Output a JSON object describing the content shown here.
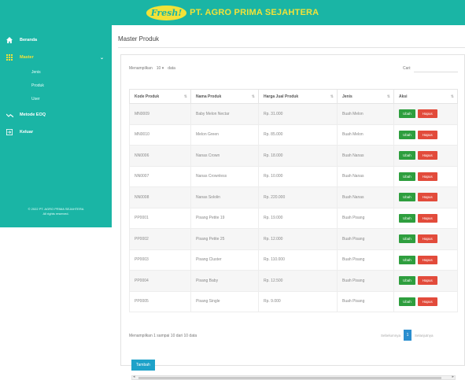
{
  "header": {
    "logo_text": "Fresh!",
    "company": "PT. AGRO PRIMA SEJAHTERA"
  },
  "sidebar": {
    "items": [
      {
        "label": "Beranda",
        "icon": "home-icon"
      },
      {
        "label": "Master",
        "icon": "grid-icon"
      },
      {
        "label": "Metode EOQ",
        "icon": "chart-icon"
      },
      {
        "label": "Keluar",
        "icon": "logout-icon"
      }
    ],
    "submenu": [
      "Jenis",
      "Produk",
      "User"
    ],
    "footer_line1": "© 2022 PT. AGRO PRIMA SEJAHTERA",
    "footer_line2": "All rights reserved."
  },
  "main": {
    "title": "Master Produk",
    "show_label": "Menampilkan",
    "show_value": "10",
    "show_suffix": "data",
    "search_label": "Cari:",
    "columns": [
      "Kode Produk",
      "Nama Produk",
      "Harga Jual Produk",
      "Jenis",
      "Aksi"
    ],
    "rows": [
      [
        "MN0009",
        "Baby Melon Nectar",
        "Rp. 31.000",
        "Buah Melon"
      ],
      [
        "MN0010",
        "Melon Green",
        "Rp. 85.000",
        "Buah Melon"
      ],
      [
        "NN0006",
        "Nanas Crown",
        "Rp. 18.000",
        "Buah Nanas"
      ],
      [
        "NN0007",
        "Nanas Crownless",
        "Rp. 10.000",
        "Buah Nanas"
      ],
      [
        "NN0008",
        "Nanas Sololin",
        "Rp. 220.000",
        "Buah Nanas"
      ],
      [
        "PP0001",
        "Pisang Petite 19",
        "Rp. 19.000",
        "Buah Pisang"
      ],
      [
        "PP0002",
        "Pisang Petite 25",
        "Rp. 12.000",
        "Buah Pisang"
      ],
      [
        "PP0003",
        "Pisang Cluster",
        "Rp. 110.000",
        "Buah Pisang"
      ],
      [
        "PP0004",
        "Pisang Baby",
        "Rp. 12.500",
        "Buah Pisang"
      ],
      [
        "PP0005",
        "Pisang Single",
        "Rp. 9.000",
        "Buah Pisang"
      ]
    ],
    "edit_label": "Ubah",
    "delete_label": "Hapus",
    "info": "Menampilkan 1 sampai 10 dari 10 data",
    "prev_label": "Sebelumnya",
    "page": "1",
    "next_label": "Selanjutnya",
    "add_label": "Tambah"
  },
  "colors": {
    "teal": "#1ab5a5",
    "yellow": "#f2e238",
    "green": "#2e9e3e",
    "red": "#e24b3b",
    "blue": "#2b8ecf"
  }
}
